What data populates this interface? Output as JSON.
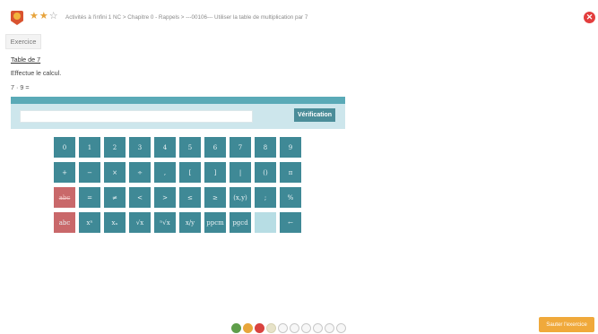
{
  "header": {
    "breadcrumb": "Activités à l'infini 1 NC > Chapitre 0 - Rappels > ---00106--- Utiliser la table de multiplication par 7",
    "stars": [
      "★",
      "★",
      "☆"
    ],
    "close_label": "✕"
  },
  "tabs": {
    "exercise": "Exercice"
  },
  "exercise": {
    "title": "Table de 7",
    "instruction": "Effectue le calcul.",
    "question": "7 · 9 ="
  },
  "answer": {
    "input_value": "",
    "verify_label": "Vérification"
  },
  "keypad": {
    "rows": [
      [
        "0",
        "1",
        "2",
        "3",
        "4",
        "5",
        "6",
        "7",
        "8",
        "9"
      ],
      [
        "+",
        "−",
        "×",
        "÷",
        ",",
        "[",
        "]",
        "|",
        "()",
        "π"
      ],
      [
        "abc",
        "=",
        "≠",
        "<",
        ">",
        "≤",
        "≥",
        "(x,y)",
        ";",
        "%"
      ],
      [
        "abc",
        "xⁿ",
        "xₙ",
        "√x",
        "ⁿ√x",
        "x/y",
        "ppcm",
        "pgcd",
        "",
        "←"
      ]
    ]
  },
  "progress": {
    "dots": [
      "green",
      "orange",
      "red",
      "pale",
      "empty",
      "empty",
      "empty",
      "empty",
      "empty",
      "empty"
    ]
  },
  "footer": {
    "skip_label": "Sauter l'exercice"
  },
  "colors": {
    "accent": "#3f8996",
    "answer_strip": "#5aaab7",
    "close": "#e33d3d",
    "skip": "#f0a93b"
  }
}
